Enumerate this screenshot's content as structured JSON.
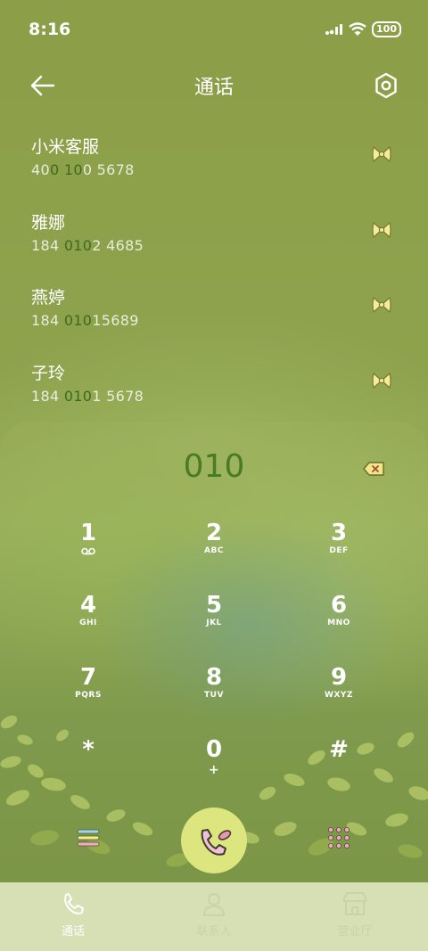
{
  "status_bar": {
    "time": "8:16",
    "battery": "100"
  },
  "header": {
    "title": "通话"
  },
  "contacts": [
    {
      "name": "小米客服",
      "number_parts": [
        "40",
        "0",
        " ",
        "10",
        "0 5678"
      ]
    },
    {
      "name": "雅娜",
      "number_parts": [
        "184 ",
        "010",
        "2 4685"
      ]
    },
    {
      "name": "燕婷",
      "number_parts": [
        "184 ",
        "010",
        "15689"
      ]
    },
    {
      "name": "子玲",
      "number_parts": [
        "184 ",
        "010",
        "1 5678"
      ]
    }
  ],
  "dialer": {
    "input": "010",
    "keys": [
      {
        "digit": "1",
        "letters": ""
      },
      {
        "digit": "2",
        "letters": "ABC"
      },
      {
        "digit": "3",
        "letters": "DEF"
      },
      {
        "digit": "4",
        "letters": "GHI"
      },
      {
        "digit": "5",
        "letters": "JKL"
      },
      {
        "digit": "6",
        "letters": "MNO"
      },
      {
        "digit": "7",
        "letters": "PQRS"
      },
      {
        "digit": "8",
        "letters": "TUV"
      },
      {
        "digit": "9",
        "letters": "WXYZ"
      },
      {
        "digit": "*",
        "letters": ""
      },
      {
        "digit": "0",
        "letters": "+"
      },
      {
        "digit": "#",
        "letters": ""
      }
    ]
  },
  "bottom_nav": {
    "items": [
      {
        "label": "通话",
        "icon": "phone-icon",
        "active": true
      },
      {
        "label": "联系人",
        "icon": "person-icon",
        "active": false
      },
      {
        "label": "营业厅",
        "icon": "store-icon",
        "active": false
      }
    ]
  },
  "colors": {
    "background": "#8a9e47",
    "highlight": "#3d6b1e",
    "dial_input": "#4a7a26",
    "call_button": "#dde57f",
    "nav_bar": "#d7e0b5"
  }
}
